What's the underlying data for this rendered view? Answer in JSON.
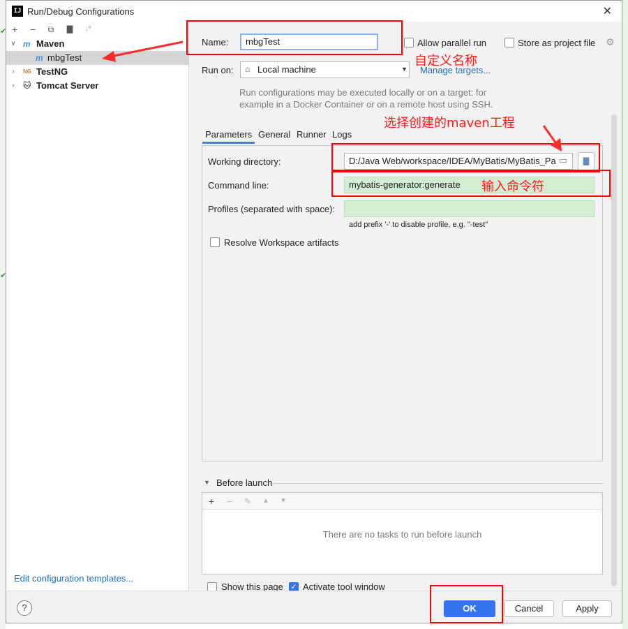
{
  "window": {
    "title": "Run/Debug Configurations",
    "app_icon_text": "IJ",
    "close_glyph": "✕"
  },
  "left_toolbar": {
    "add": "+",
    "remove": "−",
    "copy": "⧉",
    "folder": "▇",
    "sort": "↓ª"
  },
  "tree": {
    "maven": {
      "label": "Maven",
      "icon": "m"
    },
    "mbg": {
      "label": "mbgTest",
      "icon": "m"
    },
    "testng": {
      "label": "TestNG",
      "icon": "NG"
    },
    "tomcat": {
      "label": "Tomcat Server",
      "icon": "🐱"
    }
  },
  "left_footer": {
    "edit_templates": "Edit configuration templates..."
  },
  "form": {
    "name_label": "Name:",
    "name_value": "mbgTest",
    "allow_parallel": "Allow parallel run",
    "store_project": "Store as project file",
    "run_on_label": "Run on:",
    "run_on_value": "Local machine",
    "manage_targets": "Manage targets...",
    "hint_line1": "Run configurations may be executed locally or on a target: for",
    "hint_line2": "example in a Docker Container or on a remote host using SSH."
  },
  "tabs": [
    "Parameters",
    "General",
    "Runner",
    "Logs"
  ],
  "parameters": {
    "working_dir_label": "Working directory:",
    "working_dir_value": "D:/Java Web/workspace/IDEA/MyBatis/MyBatis_Pa",
    "command_label": "Command line:",
    "command_value": "mybatis-generator:generate",
    "profiles_label": "Profiles (separated with space):",
    "profiles_value": "",
    "profiles_hint": "add prefix '-' to disable profile, e.g. \"-test\"",
    "resolve_label": "Resolve Workspace artifacts"
  },
  "before_launch": {
    "title": "Before launch",
    "empty_text": "There are no tasks to run before launch"
  },
  "bottom_options": {
    "show_page": "Show this page",
    "activate_tool": "Activate tool window"
  },
  "buttons": {
    "help": "?",
    "ok": "OK",
    "cancel": "Cancel",
    "apply": "Apply"
  },
  "annotations": {
    "custom_name": "自定义名称",
    "select_project": "选择创建的maven工程",
    "enter_command": "输入命令符"
  },
  "colors": {
    "accent": "#3574f0",
    "annotation": "#ff0000",
    "link": "#2470b3"
  }
}
